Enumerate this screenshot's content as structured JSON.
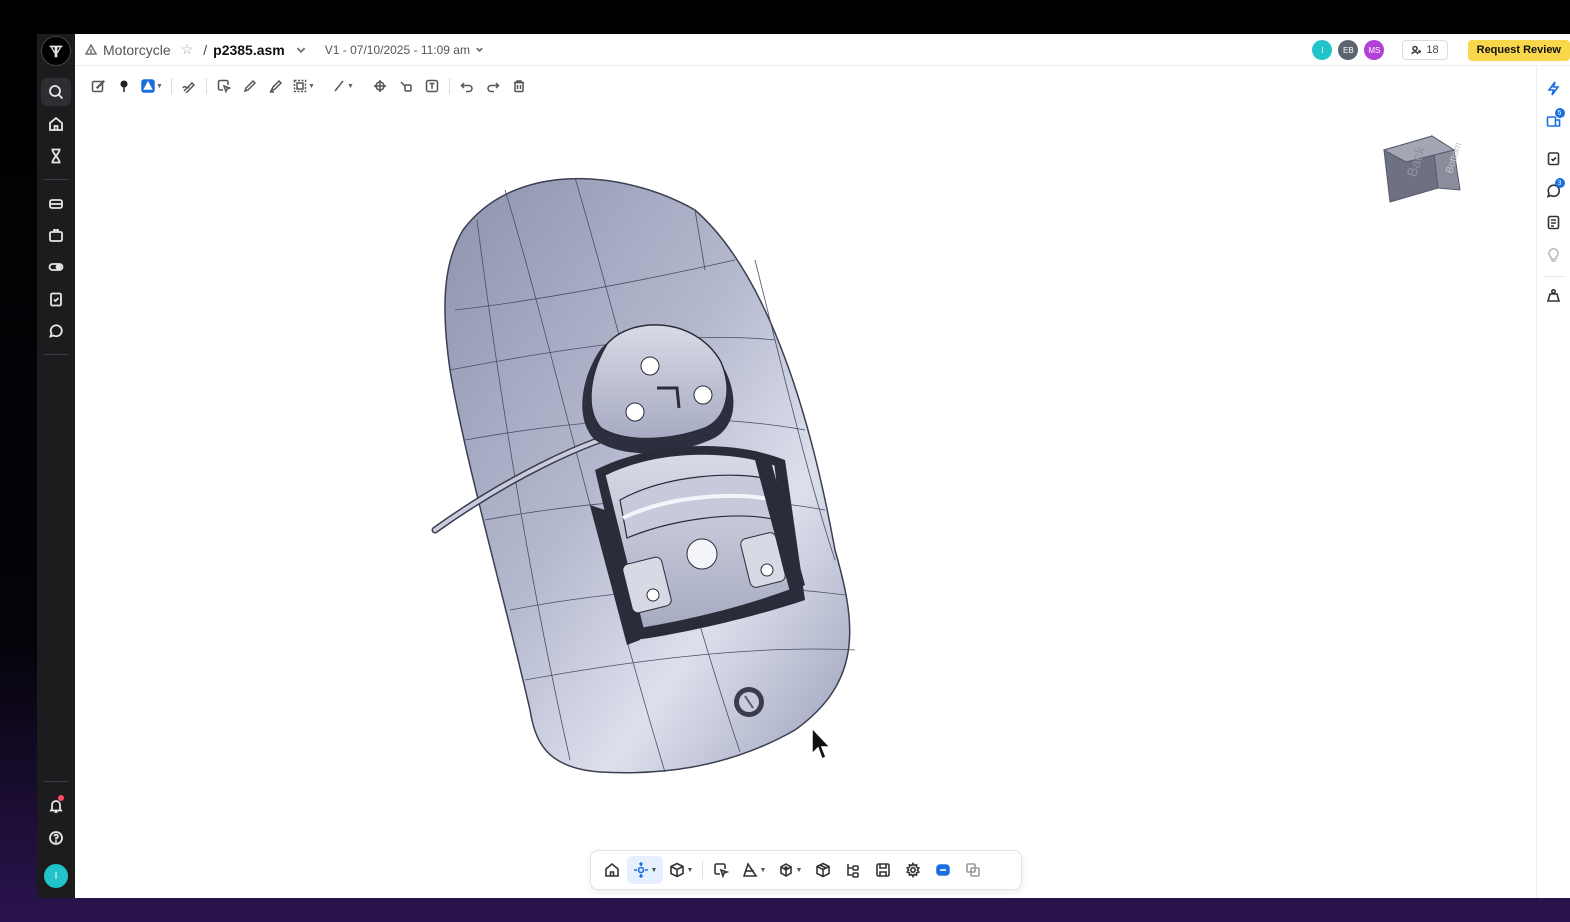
{
  "header": {
    "project": "Motorcycle",
    "separator": "/",
    "file_name": "p2385.asm",
    "version": "V1 - 07/10/2025 - 11:09 am",
    "avatars": [
      {
        "initials": "I",
        "color": "#22c4c9"
      },
      {
        "initials": "EB",
        "color": "#5b6470"
      },
      {
        "initials": "MS",
        "color": "#b23fd6"
      }
    ],
    "member_count": "18",
    "request_review_label": "Request Review"
  },
  "rail": {
    "user_initial": "I"
  },
  "right_rail": {
    "badges": [
      "5",
      "3"
    ]
  },
  "view_cube": {
    "face_front": "Back",
    "face_side": "Bottom"
  },
  "colors": {
    "accent": "#1a6fe0",
    "review": "#f9d74a",
    "rail_bg": "#1c1c1f"
  },
  "icons": {
    "left_rail": [
      "search-icon",
      "home-icon",
      "hourglass-icon",
      "drive-icon",
      "briefcase-icon",
      "toggle-icon",
      "clipboard-check-icon",
      "chat-icon",
      "bell-icon",
      "help-icon"
    ],
    "top_toolbar": [
      "edit-icon",
      "pin-icon",
      "shape-icon",
      "signature-icon",
      "select-icon",
      "pen-icon",
      "highlighter-icon",
      "area-select-icon",
      "line-icon",
      "target-icon",
      "eraser-icon",
      "text-icon",
      "undo-icon",
      "redo-icon",
      "delete-icon"
    ],
    "right_rail": [
      "lightning-icon",
      "share-icon",
      "clipboard-check-icon",
      "comment-icon",
      "checklist-icon",
      "bulb-icon",
      "weight-icon"
    ],
    "bottom_toolbar": [
      "home-view-icon",
      "orbit-icon",
      "view-cube-icon",
      "select-icon",
      "section-icon",
      "explode-icon",
      "part-icon",
      "tree-icon",
      "save-icon",
      "settings-icon",
      "badge-icon",
      "compare-icon"
    ]
  }
}
